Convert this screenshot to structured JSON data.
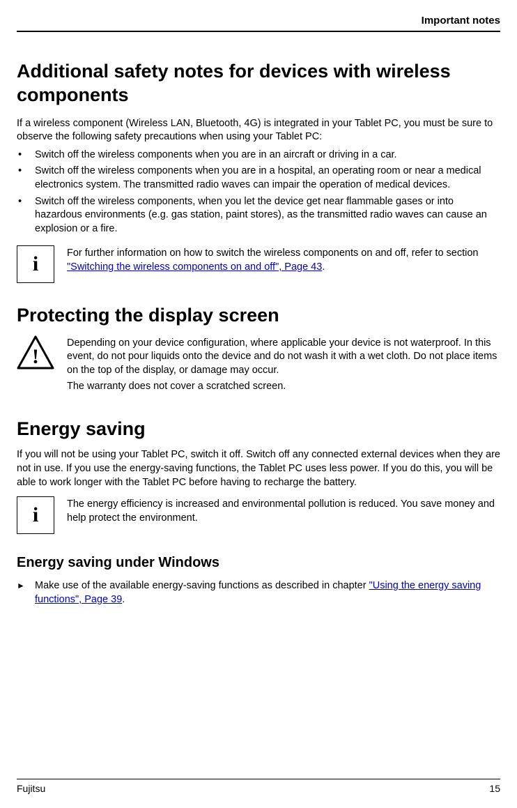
{
  "header": {
    "label": "Important notes"
  },
  "section1": {
    "title": "Additional safety notes for devices with wireless components",
    "intro": "If a wireless component (Wireless LAN, Bluetooth, 4G) is integrated in your Tablet PC, you must be sure to observe the following safety precautions when using your Tablet PC:",
    "bullets": [
      "Switch off the wireless components when you are in an aircraft or driving in a car.",
      "Switch off the wireless components when you are in a hospital, an operating room or near a medical electronics system. The transmitted radio waves can impair the operation of medical devices.",
      "Switch off the wireless components, when you let the device get near flammable gases or into hazardous environments (e.g. gas station, paint stores), as the transmitted radio waves can cause an explosion or a fire."
    ],
    "info": {
      "prefix": "For further information on how to switch the wireless components on and off, refer to section ",
      "link": "\"Switching the wireless components on and off\", Page 43",
      "suffix": "."
    }
  },
  "section2": {
    "title": "Protecting the display screen",
    "warning": {
      "p1": "Depending on your device configuration, where applicable your device is not waterproof. In this event, do not pour liquids onto the device and do not wash it with a wet cloth. Do not place items on the top of the display, or damage may occur.",
      "p2": "The warranty does not cover a scratched screen."
    }
  },
  "section3": {
    "title": "Energy saving",
    "body": "If you will not be using your Tablet PC, switch it off. Switch off any connected external devices when they are not in use. If you use the energy-saving functions, the Tablet PC uses less power. If you do this, you will be able to work longer with the Tablet PC before having to recharge the battery.",
    "info": {
      "p1": "The energy efficiency is increased and environmental pollution is reduced. You save money and help protect the environment."
    }
  },
  "section4": {
    "title": "Energy saving under Windows",
    "item": {
      "prefix": "Make use of the available energy-saving functions as described in chapter ",
      "link": "\"Using the energy saving functions\", Page 39",
      "suffix": "."
    }
  },
  "footer": {
    "brand": "Fujitsu",
    "page": "15"
  }
}
